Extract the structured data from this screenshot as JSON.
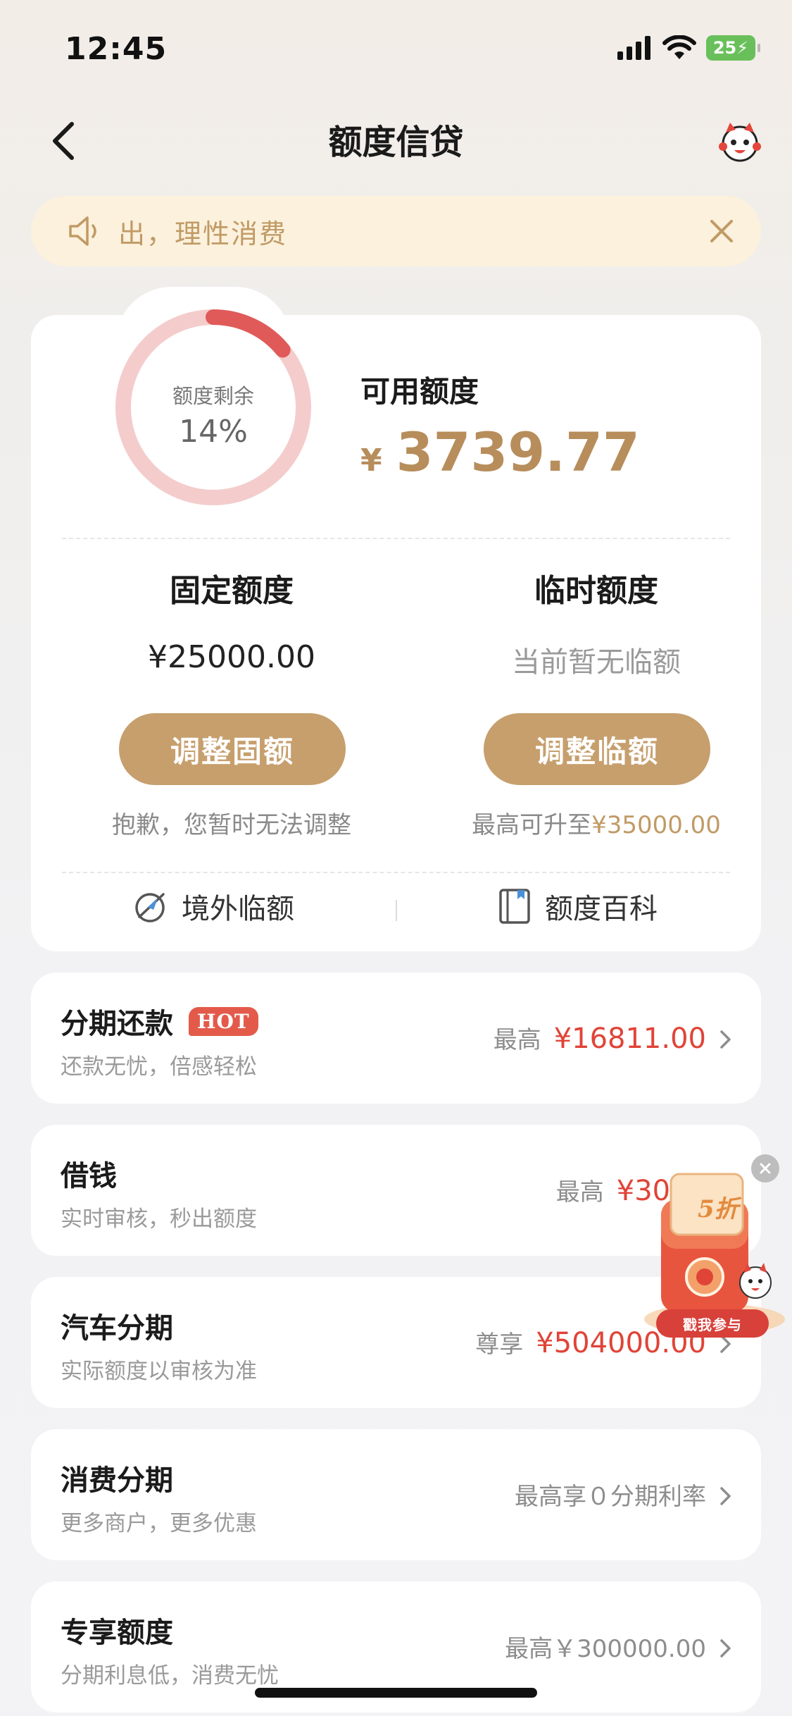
{
  "status_bar": {
    "time": "12:45",
    "battery": "25"
  },
  "nav": {
    "title": "额度信贷"
  },
  "notice": {
    "text": "出，理性消费"
  },
  "credit": {
    "ring_label": "额度剩余",
    "ring_percent": "14%",
    "remaining_fraction": 0.14,
    "available_label": "可用额度",
    "currency_symbol": "¥",
    "available_amount": "3739.77",
    "fixed": {
      "title": "固定额度",
      "value": "¥25000.00",
      "button": "调整固额",
      "note": "抱歉，您暂时无法调整"
    },
    "temporary": {
      "title": "临时额度",
      "value": "当前暂无临额",
      "button": "调整临额",
      "note_prefix": "最高可升至",
      "note_amount": "¥35000.00"
    },
    "links": {
      "overseas": "境外临额",
      "wiki": "额度百科"
    }
  },
  "services": [
    {
      "title": "分期还款",
      "badge": "HOT",
      "subtitle": "还款无忧，倍感轻松",
      "prefix": "最高",
      "amount": "¥16811.00"
    },
    {
      "title": "借钱",
      "subtitle": "实时审核，秒出额度",
      "prefix": "最高",
      "amount": "¥3000"
    },
    {
      "title": "汽车分期",
      "subtitle": "实际额度以审核为准",
      "prefix": "尊享",
      "amount": "¥504000.00"
    },
    {
      "title": "消费分期",
      "subtitle": "更多商户，更多优惠",
      "amount": "最高享０分期利率"
    },
    {
      "title": "专享额度",
      "subtitle": "分期利息低，消费无忧",
      "amount": "最高￥300000.00"
    }
  ],
  "promo": {
    "discount": "5折",
    "button": "戳我参与"
  },
  "colors": {
    "gold": "#c69f6d",
    "red": "#e04437",
    "ring": "#e05a5a",
    "ring_track": "#f4cccc"
  }
}
